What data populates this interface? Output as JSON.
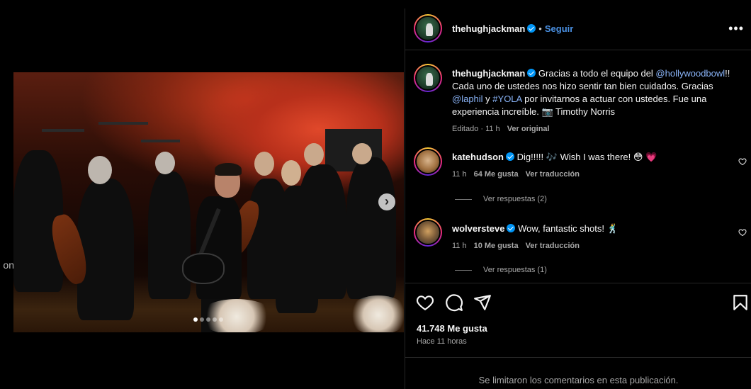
{
  "left_edge_text": "on",
  "photo": {
    "carousel_dots": 5,
    "active_dot": 0,
    "next_glyph": "›"
  },
  "header": {
    "username": "thehughjackman",
    "separator": "•",
    "follow_label": "Seguir",
    "more_glyph": "•••"
  },
  "caption": {
    "username": "thehughjackman",
    "text_1": "Gracias a todo el equipo del ",
    "mention_1": "@hollywoodbowl",
    "text_2": "!! Cada uno de ustedes nos hizo sentir tan bien cuidados. Gracias ",
    "mention_2": "@laphil",
    "text_3": " y ",
    "hashtag": "#YOLA",
    "text_4": " por invitarnos a actuar con ustedes. Fue una experiencia increíble. 📷 Timothy Norris",
    "edited": "Editado · 11 h",
    "see_original": "Ver original"
  },
  "comments": [
    {
      "username": "katehudson",
      "text": "Dig!!!!! 🎶 Wish I was there! 😳 💗",
      "time": "11 h",
      "likes": "64 Me gusta",
      "translate": "Ver traducción",
      "replies": "Ver respuestas (2)"
    },
    {
      "username": "wolversteve",
      "text": "Wow, fantastic shots! 🕺",
      "time": "11 h",
      "likes": "10 Me gusta",
      "translate": "Ver traducción",
      "replies": "Ver respuestas (1)"
    }
  ],
  "footer": {
    "likes": "41.748 Me gusta",
    "time": "Hace 11 horas",
    "limited_notice": "Se limitaron los comentarios en esta publicación."
  }
}
